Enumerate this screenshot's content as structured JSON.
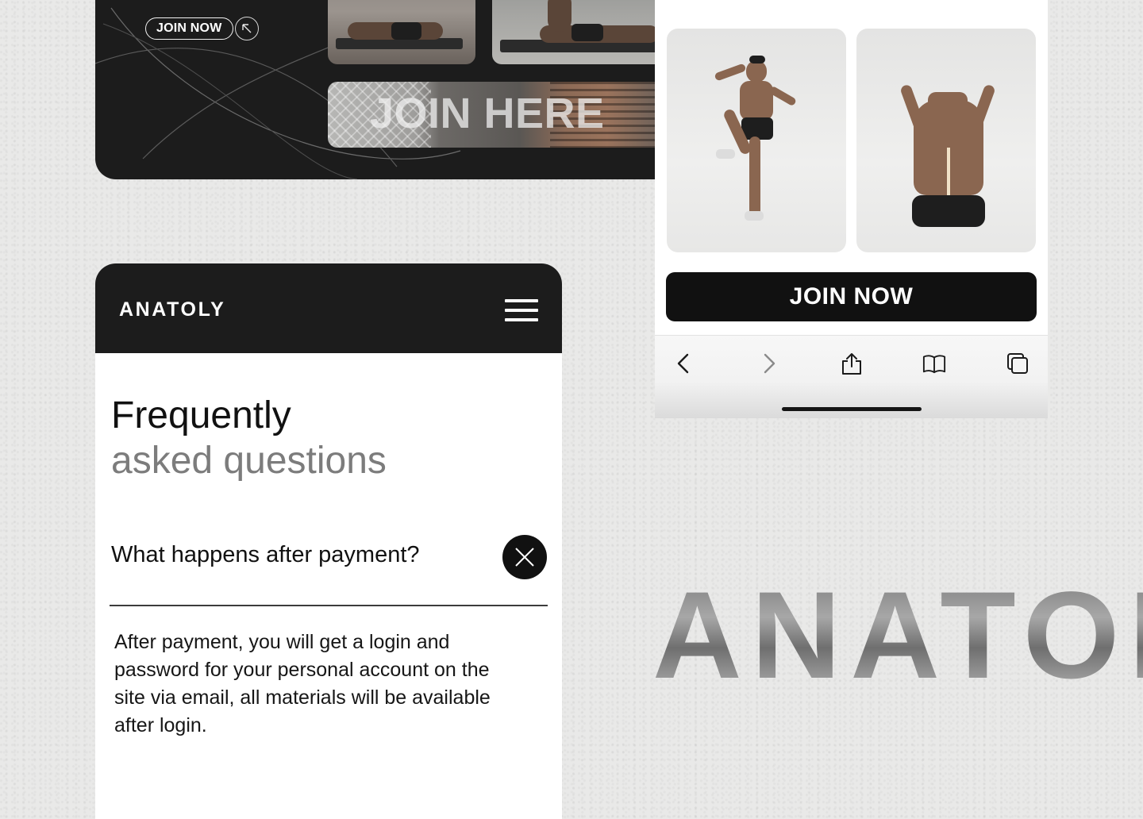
{
  "top_card": {
    "join_now_label": "JOIN NOW",
    "banner_text": "JOIN HERE"
  },
  "faq_card": {
    "brand": "ANATOLY",
    "title_line1": "Frequently",
    "title_line2": "asked questions",
    "question": "What happens after payment?",
    "answer": "After payment, you will get a login and password for your personal account on the site via email, all materials will be available after login."
  },
  "mobile_card": {
    "join_now_label": "JOIN NOW",
    "browser_icons": [
      "back-icon",
      "forward-icon",
      "share-icon",
      "bookmarks-icon",
      "tabs-icon"
    ]
  },
  "wordmark": "ANATOLY",
  "colors": {
    "dark": "#1c1c1c",
    "background": "#e9e9e8",
    "muted_text": "#7c7c7c"
  }
}
